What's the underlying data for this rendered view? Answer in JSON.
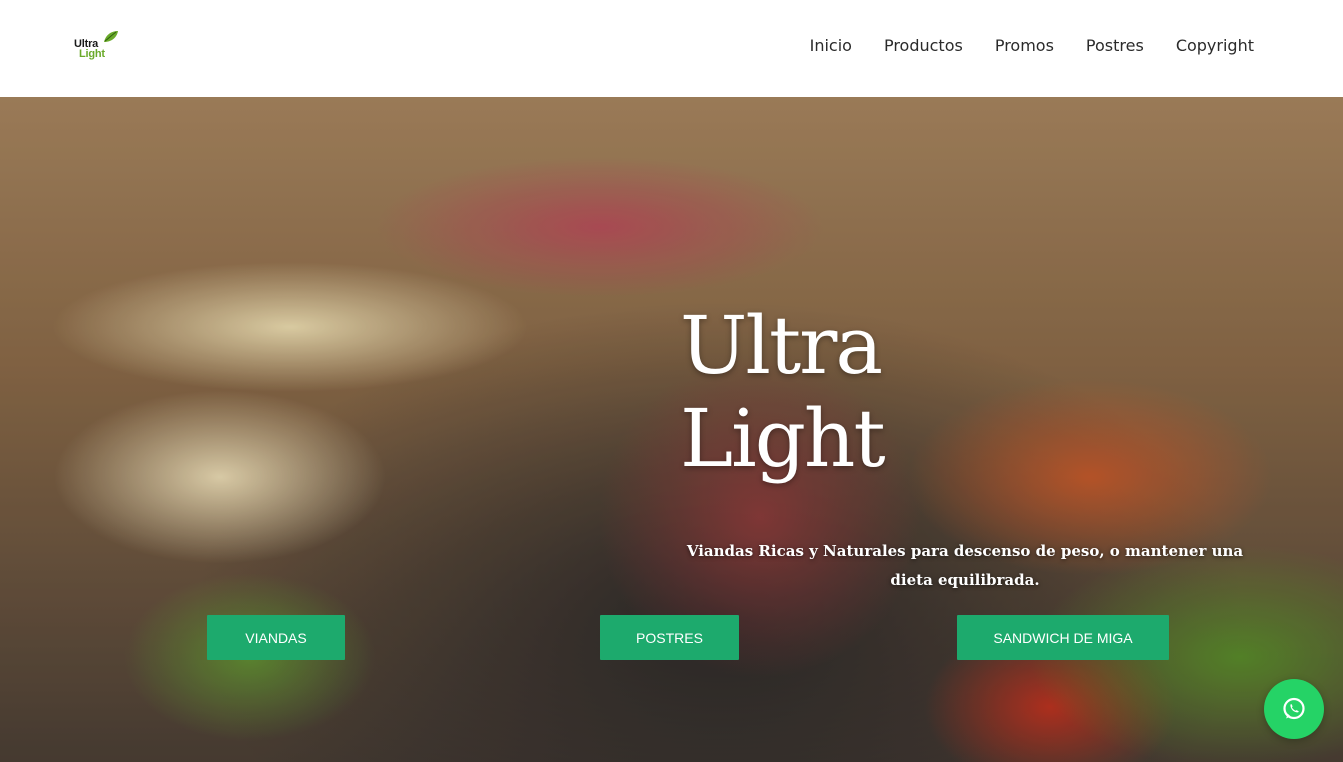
{
  "brand": {
    "logo_line1": "Ultra",
    "logo_line2": "Light"
  },
  "nav": {
    "items": [
      {
        "label": "Inicio"
      },
      {
        "label": "Productos"
      },
      {
        "label": "Promos"
      },
      {
        "label": "Postres"
      },
      {
        "label": "Copyright"
      }
    ]
  },
  "hero": {
    "title_line1": "Ultra",
    "title_line2": "Light",
    "subtitle": "Viandas Ricas y Naturales para descenso de peso, o mantener una dieta equilibrada.",
    "buttons": [
      {
        "label": "VIANDAS"
      },
      {
        "label": "POSTRES"
      },
      {
        "label": "SANDWICH DE MIGA"
      }
    ]
  },
  "floating": {
    "icon": "whatsapp-icon"
  },
  "colors": {
    "accent_green": "#1daa6d",
    "whatsapp_green": "#25d366",
    "logo_green": "#6aaa2a"
  }
}
